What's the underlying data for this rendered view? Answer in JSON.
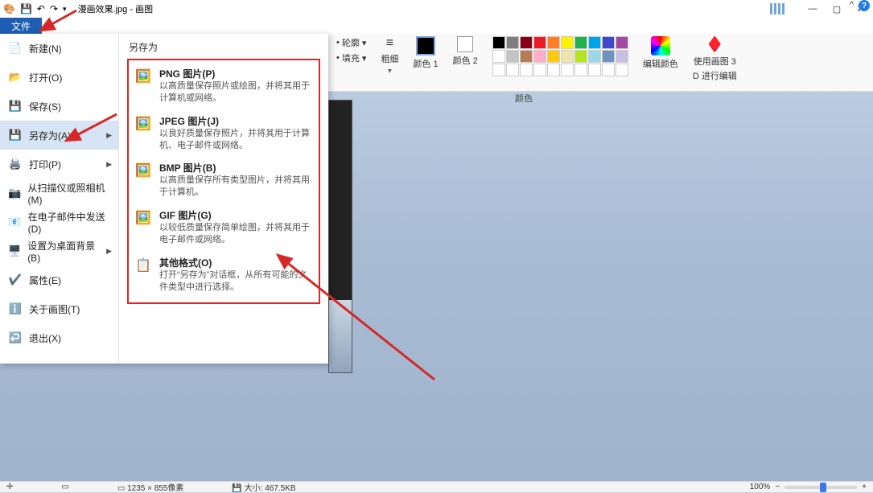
{
  "titlebar": {
    "filename": "漫画效果.jpg - 画图",
    "minimize": "—",
    "maximize": "▢",
    "close": "✕"
  },
  "file_tab": "文件",
  "menu": {
    "items": [
      {
        "icon": "📄",
        "label": "新建(N)"
      },
      {
        "icon": "📂",
        "label": "打开(O)"
      },
      {
        "icon": "💾",
        "label": "保存(S)"
      },
      {
        "icon": "💾",
        "label": "另存为(A)",
        "arrow": "▶",
        "selected": true
      },
      {
        "icon": "🖨️",
        "label": "打印(P)",
        "arrow": "▶"
      },
      {
        "icon": "📷",
        "label": "从扫描仪或照相机(M)"
      },
      {
        "icon": "📧",
        "label": "在电子邮件中发送(D)"
      },
      {
        "icon": "🖥️",
        "label": "设置为桌面背景(B)",
        "arrow": "▶"
      },
      {
        "icon": "✔️",
        "label": "属性(E)"
      },
      {
        "icon": "ℹ️",
        "label": "关于画图(T)"
      },
      {
        "icon": "↩️",
        "label": "退出(X)"
      }
    ],
    "submenu_title": "另存为",
    "sub": [
      {
        "icon": "🖼️",
        "title": "PNG 图片(P)",
        "desc": "以高质量保存照片或绘图，并将其用于计算机或网络。"
      },
      {
        "icon": "🖼️",
        "title": "JPEG 图片(J)",
        "desc": "以良好质量保存照片，并将其用于计算机、电子邮件或网络。"
      },
      {
        "icon": "🖼️",
        "title": "BMP 图片(B)",
        "desc": "以高质量保存所有类型图片，并将其用于计算机。"
      },
      {
        "icon": "🖼️",
        "title": "GIF 图片(G)",
        "desc": "以较低质量保存简单绘图，并将其用于电子邮件或网络。"
      },
      {
        "icon": "📋",
        "title": "其他格式(O)",
        "desc": "打开“另存为”对话框，从所有可能的文件类型中进行选择。"
      }
    ]
  },
  "ribbon": {
    "outline": "轮廓 ▾",
    "fill": "填充 ▾",
    "thickness": "粗细",
    "color1_label": "颜色 1",
    "color2_label": "颜色 2",
    "edit_colors": "编辑颜色",
    "paint3d_line1": "使用画图 3",
    "paint3d_line2": "D 进行编辑",
    "group_colors": "颜色",
    "palette": [
      "#000000",
      "#7f7f7f",
      "#880015",
      "#ed1c24",
      "#ff7f27",
      "#fff200",
      "#22b14c",
      "#00a2e8",
      "#3f48cc",
      "#a349a4",
      "#ffffff",
      "#c3c3c3",
      "#b97a57",
      "#ffaec9",
      "#ffc90e",
      "#efe4b0",
      "#b5e61d",
      "#99d9ea",
      "#7092be",
      "#c8bfe7",
      "#ffffff",
      "#ffffff",
      "#ffffff",
      "#ffffff",
      "#ffffff",
      "#ffffff",
      "#ffffff",
      "#ffffff",
      "#ffffff",
      "#ffffff"
    ]
  },
  "status": {
    "dims": "1235 × 855像素",
    "size": "大小: 467.5KB",
    "zoom": "100%"
  }
}
